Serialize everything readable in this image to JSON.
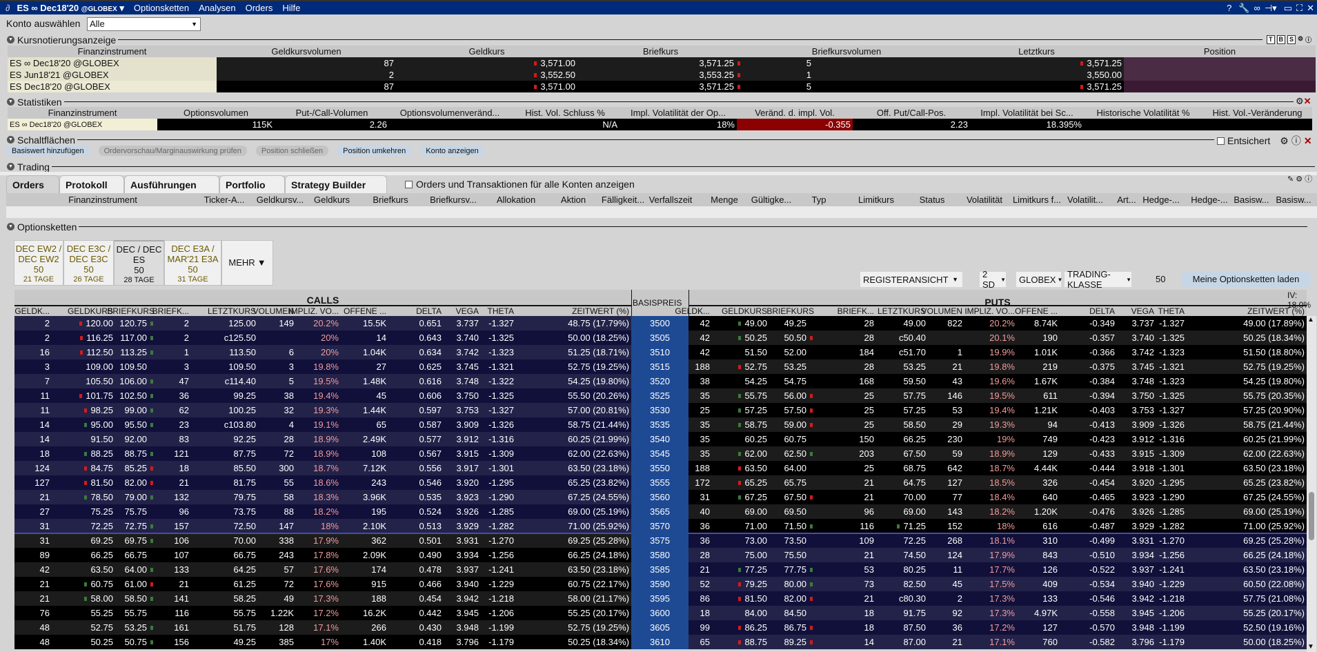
{
  "titlebar": {
    "instrument": "ES ∞ Dec18'20",
    "exchange": "@GLOBEX",
    "menu": [
      "Optionsketten",
      "Analysen",
      "Orders",
      "Hilfe"
    ],
    "help": "?"
  },
  "account": {
    "label": "Konto auswählen",
    "value": "Alle"
  },
  "quote": {
    "title": "Kursnotierungsanzeige",
    "toolbar": [
      "T",
      "B",
      "S"
    ],
    "columns": [
      "Finanzinstrument",
      "Geldkursvolumen",
      "Geldkurs",
      "Briefkurs",
      "Briefkursvolumen",
      "Letztkurs",
      "Position"
    ],
    "rows": [
      {
        "instrument": "ES ∞ Dec18'20 @GLOBEX",
        "bid_size": "87",
        "bid": "3,571.00",
        "bid_tick": "r",
        "ask": "3,571.25",
        "ask_tick": "r",
        "ask_size": "5",
        "last": "3,571.25",
        "last_tick": "r",
        "position": ""
      },
      {
        "instrument": "ES Jun18'21 @GLOBEX",
        "bid_size": "2",
        "bid": "3,552.50",
        "bid_tick": "r",
        "ask": "3,553.25",
        "ask_tick": "r",
        "ask_size": "1",
        "last": "3,550.00",
        "last_tick": "",
        "position": ""
      },
      {
        "instrument": "ES Dec18'20 @GLOBEX",
        "bid_size": "87",
        "bid": "3,571.00",
        "bid_tick": "r",
        "ask": "3,571.25",
        "ask_tick": "r",
        "ask_size": "5",
        "last": "3,571.25",
        "last_tick": "r",
        "position": ""
      }
    ]
  },
  "stats": {
    "title": "Statistiken",
    "columns": [
      "Finanzinstrument",
      "Optionsvolumen",
      "Put-/Call-Volumen",
      "Optionsvolumenveränd...",
      "Hist. Vol. Schluss %",
      "Impl. Volatilität der Op...",
      "Veränd. d. impl. Vol.",
      "Off. Put/Call-Pos.",
      "Impl. Volatilität bei Sc...",
      "Historische Volatilität %",
      "Hist. Vol.-Veränderung"
    ],
    "values": [
      "ES ∞ Dec18'20 @GLOBEX",
      "115K",
      "2.26",
      "",
      "N/A",
      "18%",
      "-0.355",
      "2.23",
      "18.395%",
      "",
      ""
    ]
  },
  "buttons_section": {
    "title": "Schaltflächen",
    "buttons": [
      {
        "label": "Basiswert hinzufügen",
        "enabled": true
      },
      {
        "label": "Ordervorschau/Marginauswirkung prüfen",
        "enabled": false
      },
      {
        "label": "Position schließen",
        "enabled": false
      },
      {
        "label": "Position umkehren",
        "enabled": true
      },
      {
        "label": "Konto anzeigen",
        "enabled": true
      }
    ],
    "entsichert": "Entsichert"
  },
  "trading": {
    "title": "Trading",
    "tabs": [
      "Orders",
      "Protokoll",
      "Ausführungen",
      "Portfolio",
      "Strategy Builder"
    ],
    "all_accounts_label": "Orders und Transaktionen für alle Konten anzeigen",
    "columns": [
      "Finanzinstrument",
      "Ticker-A...",
      "Geldkursv...",
      "Geldkurs",
      "Briefkurs",
      "Briefkursv...",
      "Allokation",
      "Aktion",
      "Fälligkeit...",
      "Verfallszeit",
      "Menge",
      "Gültigke...",
      "Typ",
      "Limitkurs",
      "Status",
      "Volatilität",
      "Limitkurs f...",
      "Volatilit...",
      "Art...",
      "Hedge-...",
      "Hedge-...",
      "Basisw...",
      "Basisw..."
    ]
  },
  "chains": {
    "title": "Optionsketten",
    "tabs": [
      {
        "l1": "DEC EW2 /",
        "l2": "DEC EW2",
        "mult": "50",
        "days": "21 TAGE"
      },
      {
        "l1": "DEC E3C /",
        "l2": "DEC E3C",
        "mult": "50",
        "days": "26 TAGE"
      },
      {
        "l1": "DEC / DEC",
        "l2": "ES",
        "mult": "50",
        "days": "28 TAGE",
        "selected": true
      },
      {
        "l1": "DEC E3A /",
        "l2": "MAR'21 E3A",
        "mult": "50",
        "days": "31 TAGE"
      }
    ],
    "more": "MEHR",
    "view": "REGISTERANSICHT",
    "range": "2 SD",
    "exchange": "GLOBEX",
    "trading_class": "TRADING-KLASSE",
    "multiplier": "50",
    "load_button": "Meine Optionsketten laden",
    "iv": "IV: 18.0%",
    "calls_label": "CALLS",
    "puts_label": "PUTS",
    "strike_label": "BASISPREIS",
    "columns": [
      "GELDK...",
      "GELDKURS",
      "BRIEFKURS",
      "BRIEFK...",
      "LETZTKURS",
      "VOLUMEN",
      "IMPLIZ. VO...",
      "OFFENE ...",
      "DELTA",
      "VEGA",
      "THETA",
      "ZEITWERT (%)"
    ],
    "strikes": [
      "3500",
      "3505",
      "3510",
      "3515",
      "3520",
      "3525",
      "3530",
      "3535",
      "3540",
      "3545",
      "3550",
      "3555",
      "3560",
      "3565",
      "3570",
      "3575",
      "3580",
      "3585",
      "3590",
      "3595",
      "3600",
      "3605",
      "3610"
    ],
    "calls": [
      [
        "2",
        "120.00|r",
        "120.75|g",
        "2",
        "125.00",
        "149",
        "20.2%",
        "15.5K",
        "0.651",
        "3.737",
        "-1.327",
        "48.75 (17.79%)"
      ],
      [
        "2",
        "116.25|r",
        "117.00|g",
        "2",
        "c125.50",
        "",
        "20%",
        "14",
        "0.643",
        "3.740",
        "-1.325",
        "50.00 (18.25%)"
      ],
      [
        "16",
        "112.50|r",
        "113.25|g",
        "1",
        "113.50",
        "6",
        "20%",
        "1.04K",
        "0.634",
        "3.742",
        "-1.323",
        "51.25 (18.71%)"
      ],
      [
        "3",
        "109.00",
        "109.50",
        "3",
        "109.50",
        "3",
        "19.8%",
        "27",
        "0.625",
        "3.745",
        "-1.321",
        "52.75 (19.25%)"
      ],
      [
        "7",
        "105.50",
        "106.00|g",
        "47",
        "c114.40",
        "5",
        "19.5%",
        "1.48K",
        "0.616",
        "3.748",
        "-1.322",
        "54.25 (19.80%)"
      ],
      [
        "11",
        "101.75|r",
        "102.50|g",
        "36",
        "99.25",
        "38",
        "19.4%",
        "45",
        "0.606",
        "3.750",
        "-1.325",
        "55.50 (20.26%)"
      ],
      [
        "11",
        "98.25|r",
        "99.00|g",
        "62",
        "100.25",
        "32",
        "19.3%",
        "1.44K",
        "0.597",
        "3.753",
        "-1.327",
        "57.00 (20.81%)"
      ],
      [
        "14",
        "95.00|g",
        "95.50|g",
        "23",
        "c103.80",
        "4",
        "19.1%",
        "65",
        "0.587",
        "3.909",
        "-1.326",
        "58.75 (21.44%)"
      ],
      [
        "14",
        "91.50",
        "92.00",
        "83",
        "92.25",
        "28",
        "18.9%",
        "2.49K",
        "0.577",
        "3.912",
        "-1.316",
        "60.25 (21.99%)"
      ],
      [
        "18",
        "88.25|g",
        "88.75|g",
        "121",
        "87.75",
        "72",
        "18.9%",
        "108",
        "0.567",
        "3.915",
        "-1.309",
        "62.00 (22.63%)"
      ],
      [
        "124",
        "84.75|r",
        "85.25|r",
        "18",
        "85.50",
        "300",
        "18.7%",
        "7.12K",
        "0.556",
        "3.917",
        "-1.301",
        "63.50 (23.18%)"
      ],
      [
        "127",
        "81.50|r",
        "82.00|r",
        "21",
        "81.75",
        "55",
        "18.6%",
        "243",
        "0.546",
        "3.920",
        "-1.295",
        "65.25 (23.82%)"
      ],
      [
        "21",
        "78.50|g",
        "79.00|g",
        "132",
        "79.75",
        "58",
        "18.3%",
        "3.96K",
        "0.535",
        "3.923",
        "-1.290",
        "67.25 (24.55%)"
      ],
      [
        "27",
        "75.25",
        "75.75",
        "96",
        "73.75",
        "88",
        "18.2%",
        "195",
        "0.524",
        "3.926",
        "-1.285",
        "69.00 (25.19%)"
      ],
      [
        "31",
        "72.25",
        "72.75|g",
        "157",
        "72.50",
        "147",
        "18%",
        "2.10K",
        "0.513",
        "3.929",
        "-1.282",
        "71.00 (25.92%)"
      ],
      [
        "31",
        "69.25",
        "69.75|g",
        "106",
        "70.00",
        "338",
        "17.9%",
        "362",
        "0.501",
        "3.931",
        "-1.270",
        "69.25 (25.28%)"
      ],
      [
        "89",
        "66.25",
        "66.75",
        "107",
        "66.75",
        "243",
        "17.8%",
        "2.09K",
        "0.490",
        "3.934",
        "-1.256",
        "66.25 (24.18%)"
      ],
      [
        "42",
        "63.50",
        "64.00|g",
        "133",
        "64.25",
        "57",
        "17.6%",
        "174",
        "0.478",
        "3.937",
        "-1.241",
        "63.50 (23.18%)"
      ],
      [
        "21",
        "60.75|g",
        "61.00|r",
        "21",
        "61.25",
        "72",
        "17.6%",
        "915",
        "0.466",
        "3.940",
        "-1.229",
        "60.75 (22.17%)"
      ],
      [
        "21",
        "58.00|g",
        "58.50|g",
        "141",
        "58.25",
        "49",
        "17.3%",
        "188",
        "0.454",
        "3.942",
        "-1.218",
        "58.00 (21.17%)"
      ],
      [
        "76",
        "55.25",
        "55.75",
        "116",
        "55.75",
        "1.22K",
        "17.2%",
        "16.2K",
        "0.442",
        "3.945",
        "-1.206",
        "55.25 (20.17%)"
      ],
      [
        "48",
        "52.75",
        "53.25|g",
        "161",
        "51.75",
        "128",
        "17.1%",
        "266",
        "0.430",
        "3.948",
        "-1.199",
        "52.75 (19.25%)"
      ],
      [
        "48",
        "50.25",
        "50.75|g",
        "156",
        "49.25",
        "385",
        "17%",
        "1.40K",
        "0.418",
        "3.796",
        "-1.179",
        "50.25 (18.34%)"
      ]
    ],
    "puts": [
      [
        "42",
        "49.00|g",
        "49.25",
        "28",
        "49.00",
        "822",
        "20.2%",
        "8.74K",
        "-0.349",
        "3.737",
        "-1.327",
        "49.00 (17.89%)"
      ],
      [
        "42",
        "50.25|g",
        "50.50|r",
        "28",
        "c50.40",
        "",
        "20.1%",
        "190",
        "-0.357",
        "3.740",
        "-1.325",
        "50.25 (18.34%)"
      ],
      [
        "42",
        "51.50",
        "52.00",
        "184",
        "c51.70",
        "1",
        "19.9%",
        "1.01K",
        "-0.366",
        "3.742",
        "-1.323",
        "51.50 (18.80%)"
      ],
      [
        "188",
        "52.75|r",
        "53.25",
        "28",
        "53.25",
        "21",
        "19.8%",
        "219",
        "-0.375",
        "3.745",
        "-1.321",
        "52.75 (19.25%)"
      ],
      [
        "38",
        "54.25",
        "54.75",
        "168",
        "59.50",
        "43",
        "19.6%",
        "1.67K",
        "-0.384",
        "3.748",
        "-1.323",
        "54.25 (19.80%)"
      ],
      [
        "35",
        "55.75|g",
        "56.00|r",
        "25",
        "57.75",
        "146",
        "19.5%",
        "611",
        "-0.394",
        "3.750",
        "-1.325",
        "55.75 (20.35%)"
      ],
      [
        "25",
        "57.25|g",
        "57.50|r",
        "25",
        "57.25",
        "53",
        "19.4%",
        "1.21K",
        "-0.403",
        "3.753",
        "-1.327",
        "57.25 (20.90%)"
      ],
      [
        "35",
        "58.75|g",
        "59.00|r",
        "25",
        "58.50",
        "29",
        "19.3%",
        "94",
        "-0.413",
        "3.909",
        "-1.326",
        "58.75 (21.44%)"
      ],
      [
        "35",
        "60.25",
        "60.75",
        "150",
        "66.25",
        "230",
        "19%",
        "749",
        "-0.423",
        "3.912",
        "-1.316",
        "60.25 (21.99%)"
      ],
      [
        "35",
        "62.00|g",
        "62.50|g",
        "203",
        "67.50",
        "59",
        "18.9%",
        "129",
        "-0.433",
        "3.915",
        "-1.309",
        "62.00 (22.63%)"
      ],
      [
        "188",
        "63.50|r",
        "64.00",
        "25",
        "68.75",
        "642",
        "18.7%",
        "4.44K",
        "-0.444",
        "3.918",
        "-1.301",
        "63.50 (23.18%)"
      ],
      [
        "172",
        "65.25|r",
        "65.75",
        "21",
        "64.75",
        "127",
        "18.5%",
        "326",
        "-0.454",
        "3.920",
        "-1.295",
        "65.25 (23.82%)"
      ],
      [
        "31",
        "67.25|g",
        "67.50|r",
        "21",
        "70.00",
        "77",
        "18.4%",
        "640",
        "-0.465",
        "3.923",
        "-1.290",
        "67.25 (24.55%)"
      ],
      [
        "40",
        "69.00",
        "69.50",
        "96",
        "69.00",
        "143",
        "18.2%",
        "1.20K",
        "-0.476",
        "3.926",
        "-1.285",
        "69.00 (25.19%)"
      ],
      [
        "36",
        "71.00",
        "71.50|g",
        "116",
        "71.25|g",
        "152",
        "18%",
        "616",
        "-0.487",
        "3.929",
        "-1.282",
        "71.00 (25.92%)"
      ],
      [
        "36",
        "73.00",
        "73.50",
        "109",
        "72.25",
        "268",
        "18.1%",
        "310",
        "-0.499",
        "3.931",
        "-1.270",
        "69.25 (25.28%)"
      ],
      [
        "28",
        "75.00",
        "75.50",
        "21",
        "74.50",
        "124",
        "17.9%",
        "843",
        "-0.510",
        "3.934",
        "-1.256",
        "66.25 (24.18%)"
      ],
      [
        "21",
        "77.25|g",
        "77.75|g",
        "53",
        "80.25",
        "11",
        "17.7%",
        "126",
        "-0.522",
        "3.937",
        "-1.241",
        "63.50 (23.18%)"
      ],
      [
        "52",
        "79.25|r",
        "80.00|g",
        "73",
        "82.50",
        "45",
        "17.5%",
        "409",
        "-0.534",
        "3.940",
        "-1.229",
        "60.50 (22.08%)"
      ],
      [
        "86",
        "81.50|r",
        "82.00|r",
        "21",
        "c80.30",
        "2",
        "17.3%",
        "133",
        "-0.546",
        "3.942",
        "-1.218",
        "57.75 (21.08%)"
      ],
      [
        "18",
        "84.00",
        "84.50",
        "18",
        "91.75",
        "92",
        "17.3%",
        "4.97K",
        "-0.558",
        "3.945",
        "-1.206",
        "55.25 (20.17%)"
      ],
      [
        "99",
        "86.25|r",
        "86.75|r",
        "18",
        "87.50",
        "36",
        "17.2%",
        "127",
        "-0.570",
        "3.948",
        "-1.199",
        "52.50 (19.16%)"
      ],
      [
        "65",
        "88.75|r",
        "89.25|r",
        "14",
        "87.00",
        "21",
        "17.1%",
        "760",
        "-0.582",
        "3.796",
        "-1.179",
        "50.00 (18.25%)"
      ]
    ],
    "atm_after_strike": "3570"
  },
  "colors": {
    "titlebar": "#002a7a",
    "strike": "#1e4a94",
    "itm_a": "#23234a",
    "itm_b": "#10103a",
    "otm_a": "#000000",
    "otm_b": "#1c1c1c",
    "iv_text": "#f29c9c",
    "down_tick": "#d21b1b",
    "up_tick": "#3c7a3c",
    "neg_change": "#8b0000"
  }
}
